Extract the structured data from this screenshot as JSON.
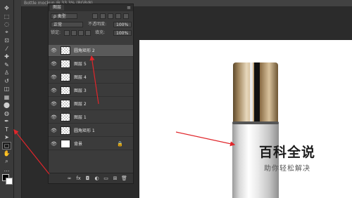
{
  "document": {
    "tab_title": "Bottle mockup @ 33.3% (RGB/8)"
  },
  "tools": [
    {
      "icon": "move-icon",
      "glyph": "✥"
    },
    {
      "icon": "marquee-icon",
      "glyph": "⬚"
    },
    {
      "icon": "lasso-icon",
      "glyph": "◌"
    },
    {
      "icon": "quick-select-icon",
      "glyph": "⌖"
    },
    {
      "icon": "crop-icon",
      "glyph": "⊡"
    },
    {
      "icon": "eyedropper-icon",
      "glyph": "⁄"
    },
    {
      "icon": "healing-icon",
      "glyph": "✚"
    },
    {
      "icon": "brush-icon",
      "glyph": "✎"
    },
    {
      "icon": "stamp-icon",
      "glyph": "♙"
    },
    {
      "icon": "history-brush-icon",
      "glyph": "↺"
    },
    {
      "icon": "eraser-icon",
      "glyph": "◫"
    },
    {
      "icon": "gradient-icon",
      "glyph": "▦"
    },
    {
      "icon": "blur-icon",
      "glyph": "⬤"
    },
    {
      "icon": "dodge-icon",
      "glyph": "◍"
    },
    {
      "icon": "pen-icon",
      "glyph": "✒"
    },
    {
      "icon": "type-icon",
      "glyph": "T"
    },
    {
      "icon": "path-select-icon",
      "glyph": "➤"
    },
    {
      "icon": "rounded-rectangle-icon",
      "glyph": "▢"
    },
    {
      "icon": "hand-icon",
      "glyph": "✋"
    },
    {
      "icon": "zoom-icon",
      "glyph": "⌕"
    },
    {
      "icon": "extras-icon",
      "glyph": "…"
    }
  ],
  "layers_panel": {
    "tab": "图层",
    "menu_icon": "≡",
    "filter": {
      "label": "ρ 类型",
      "icons": [
        "pixel-filter-icon",
        "adjust-filter-icon",
        "type-filter-icon",
        "shape-filter-icon",
        "smart-filter-icon"
      ]
    },
    "blend_mode": "正常",
    "opacity_label": "不透明度:",
    "opacity_value": "100%",
    "lock_label": "锁定:",
    "fill_label": "填充:",
    "fill_value": "100%",
    "layers": [
      {
        "name": "圆角矩形 2",
        "selected": true,
        "thumb": "shape"
      },
      {
        "name": "图层 5",
        "selected": false,
        "thumb": "checker"
      },
      {
        "name": "图层 4",
        "selected": false,
        "thumb": "checker"
      },
      {
        "name": "图层 3",
        "selected": false,
        "thumb": "checker"
      },
      {
        "name": "图层 2",
        "selected": false,
        "thumb": "checker"
      },
      {
        "name": "图层 1",
        "selected": false,
        "thumb": "checker"
      },
      {
        "name": "圆角矩形 1",
        "selected": false,
        "thumb": "shape"
      },
      {
        "name": "背景",
        "selected": false,
        "thumb": "white",
        "locked": true
      }
    ],
    "footer": [
      {
        "icon": "link-icon",
        "glyph": "∞"
      },
      {
        "icon": "fx-icon",
        "glyph": "fx"
      },
      {
        "icon": "mask-icon",
        "glyph": "◘"
      },
      {
        "icon": "adjustment-icon",
        "glyph": "◐"
      },
      {
        "icon": "folder-icon",
        "glyph": "▭"
      },
      {
        "icon": "new-layer-icon",
        "glyph": "⊞"
      },
      {
        "icon": "trash-icon",
        "glyph": "🗑"
      }
    ]
  },
  "watermark": {
    "title": "百科全说",
    "subtitle": "助你轻松解决"
  },
  "colors": {
    "annotation_red": "#e0262b",
    "panel_bg": "#3b3b3b",
    "canvas": "#ffffff"
  }
}
